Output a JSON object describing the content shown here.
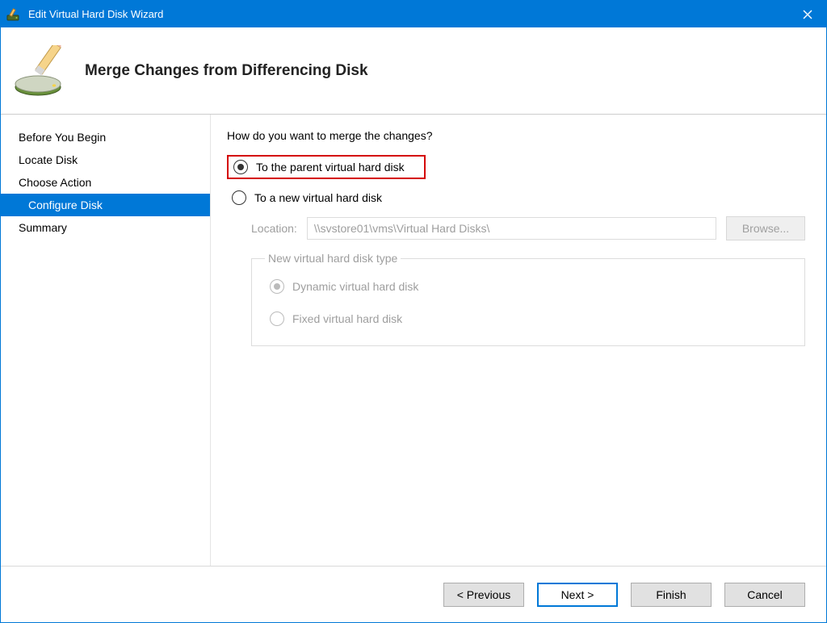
{
  "window": {
    "title": "Edit Virtual Hard Disk Wizard"
  },
  "header": {
    "heading": "Merge Changes from Differencing Disk"
  },
  "sidebar": {
    "items": [
      {
        "label": "Before You Begin",
        "active": false
      },
      {
        "label": "Locate Disk",
        "active": false
      },
      {
        "label": "Choose Action",
        "active": false
      },
      {
        "label": "Configure Disk",
        "active": true
      },
      {
        "label": "Summary",
        "active": false
      }
    ]
  },
  "content": {
    "prompt": "How do you want to merge the changes?",
    "option_parent": "To the parent virtual hard disk",
    "option_new": "To a new virtual hard disk",
    "location_label": "Location:",
    "location_value": "\\\\svstore01\\vms\\Virtual Hard Disks\\",
    "browse_label": "Browse...",
    "disk_type_legend": "New virtual hard disk type",
    "disk_type_dynamic": "Dynamic virtual hard disk",
    "disk_type_fixed": "Fixed virtual hard disk"
  },
  "footer": {
    "previous": "< Previous",
    "next": "Next >",
    "finish": "Finish",
    "cancel": "Cancel"
  }
}
